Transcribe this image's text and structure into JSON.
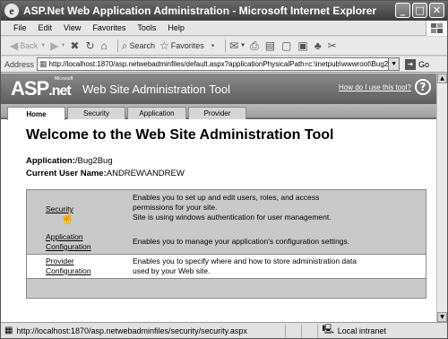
{
  "window": {
    "title": "ASP.Net Web Application Administration - Microsoft Internet Explorer",
    "buttons": {
      "minimize": "_",
      "maximize": "□",
      "close": "✕"
    }
  },
  "menu": [
    "File",
    "Edit",
    "View",
    "Favorites",
    "Tools",
    "Help"
  ],
  "toolbar": {
    "back": "Back",
    "search": "Search",
    "favorites": "Favorites"
  },
  "address": {
    "label": "Address",
    "url": "http://localhost:1870/asp.netwebadminfiles/default.aspx?applicationPhysicalPath=c:\\inetpub\\wwwroot\\Bug2B",
    "go": "Go"
  },
  "banner": {
    "logo": "ASP",
    "logo_suffix": ".net",
    "ms_mark": "Microsoft",
    "title": "Web Site Administration Tool",
    "help_link": "How do I use this tool?",
    "help_icon": "?"
  },
  "tabs": [
    "Home",
    "Security",
    "Application",
    "Provider"
  ],
  "main": {
    "heading": "Welcome to the Web Site Administration Tool",
    "application_label": "Application:",
    "application_value": "/Bug2Bug",
    "user_label": "Current User Name:",
    "user_value": "ANDREW\\ANDREW"
  },
  "sections": [
    {
      "link": "Security",
      "desc": [
        "Enables you to set up and edit users, roles, and access",
        "permissions for your site.",
        "Site is using windows authentication for user management."
      ]
    },
    {
      "link_lines": [
        "Application",
        "Configuration"
      ],
      "desc": [
        "Enables you to manage your application's configuration settings."
      ]
    },
    {
      "link_lines": [
        "Provider",
        "Configuration"
      ],
      "desc": [
        "Enables you to specify where and how to store administration data",
        "used by your Web site."
      ]
    }
  ],
  "status": {
    "url": "http://localhost:1870/asp.netwebadminfiles/security/security.aspx",
    "zone": "Local intranet"
  }
}
